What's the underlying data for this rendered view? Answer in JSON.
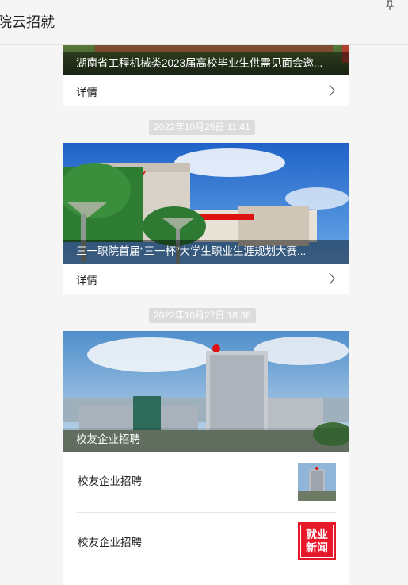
{
  "app": {
    "title": "院云招就"
  },
  "feed": {
    "post1": {
      "caption": "湖南省工程机械类2023届高校毕业生供需见面会邀...",
      "detail_label": "详情"
    },
    "post2": {
      "timestamp": "2022年10月25日  11:41",
      "caption": "三一职院首届“三一杯”大学生职业生涯规划大赛...",
      "detail_label": "详情"
    },
    "post3": {
      "timestamp": "2022年10月27日  18:36",
      "caption": "校友企业招聘",
      "items": [
        {
          "label": "校友企业招聘",
          "thumb_icon": "building-photo"
        },
        {
          "label": "校友企业招聘",
          "thumb_icon": "employment-news-badge",
          "thumb_text_1": "就业",
          "thumb_text_2": "新闻"
        }
      ]
    }
  },
  "colors": {
    "timestamp_bg": "#dcdcdc",
    "news_badge_red": "#e8182b"
  }
}
